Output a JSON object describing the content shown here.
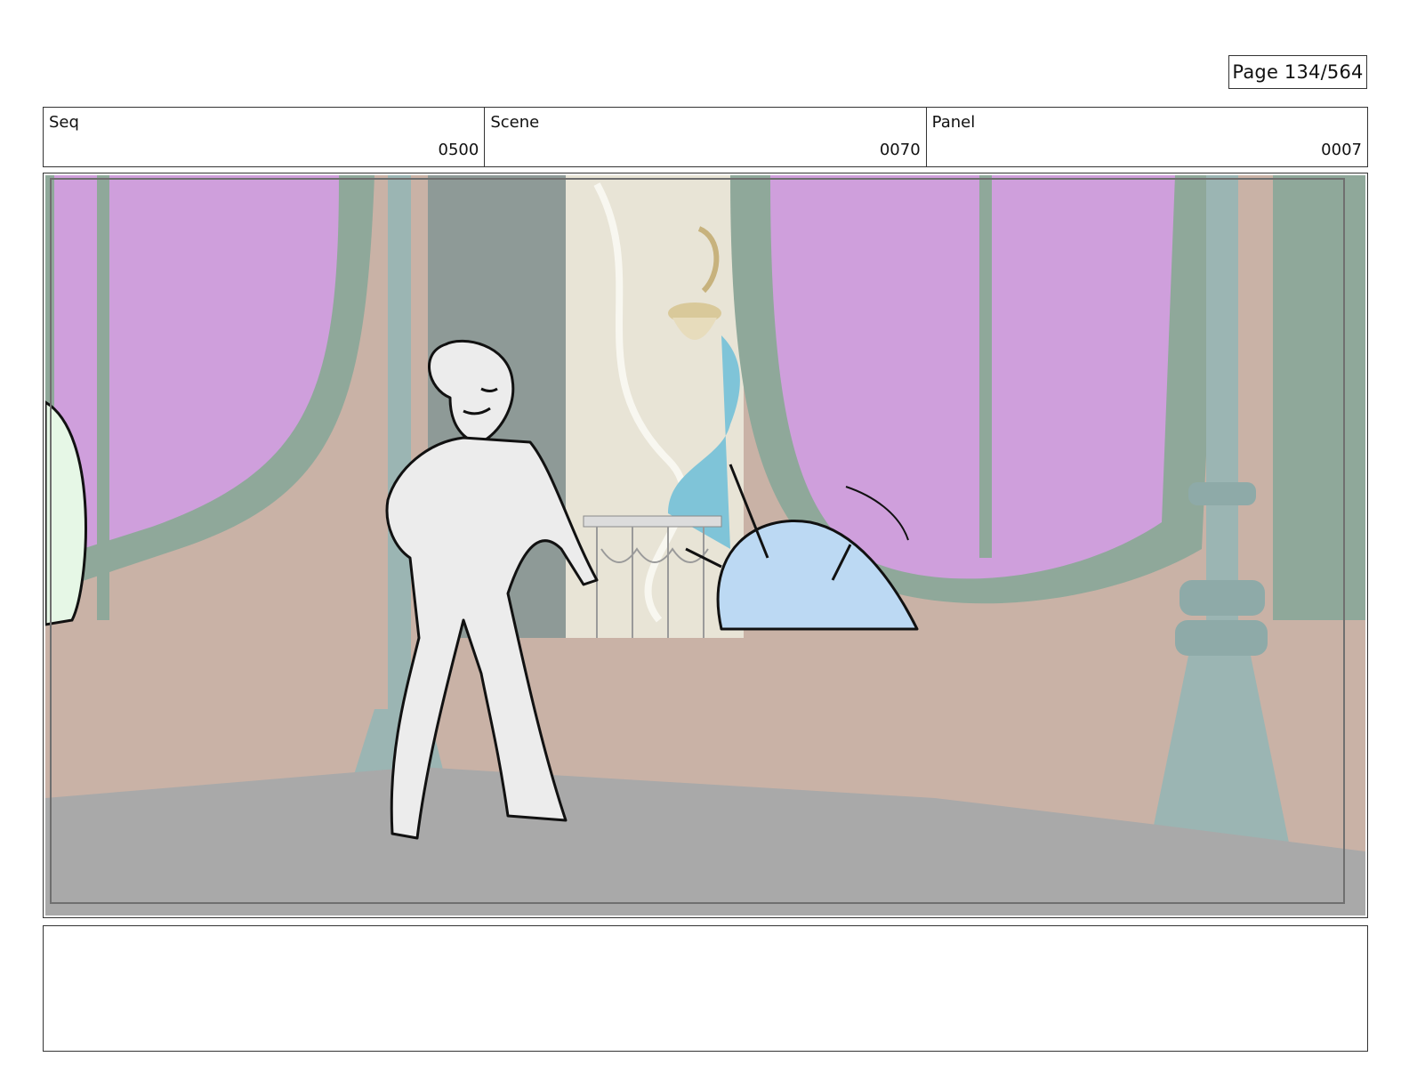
{
  "page": {
    "label": "Page 134/564"
  },
  "header": {
    "seq": {
      "label": "Seq",
      "value": "0500"
    },
    "scene": {
      "label": "Scene",
      "value": "0070"
    },
    "panel": {
      "label": "Panel",
      "value": "0007"
    }
  },
  "colors": {
    "window_glass": "#cf9fdc",
    "window_frame": "#8fa89a",
    "wall": "#c9b2a6",
    "floor": "#a9a9a9",
    "pillar": "#9bb5b3",
    "character_blue": "#bcd9f3",
    "character_white": "#ececec"
  },
  "notes": {
    "text": ""
  }
}
